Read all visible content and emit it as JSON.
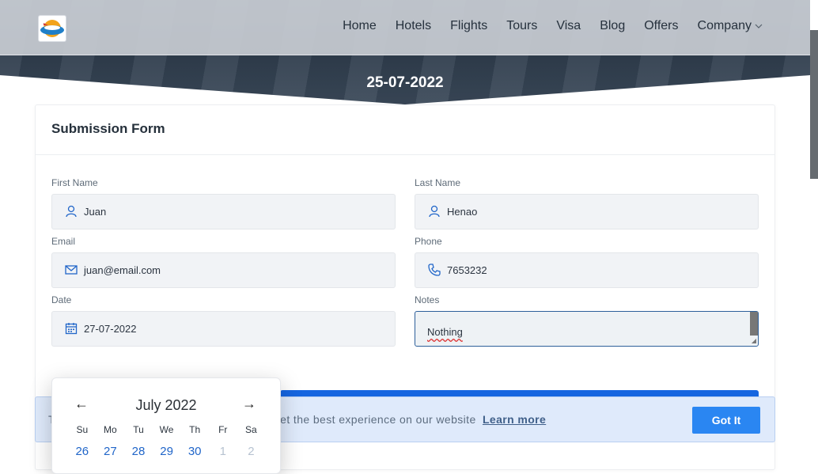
{
  "nav": {
    "logo": "logo-icon",
    "links": [
      "Home",
      "Hotels",
      "Flights",
      "Tours",
      "Visa",
      "Blog",
      "Offers",
      "Company"
    ]
  },
  "hero": {
    "date": "25-07-2022"
  },
  "form": {
    "title": "Submission Form",
    "first_name": {
      "label": "First Name",
      "value": "Juan"
    },
    "last_name": {
      "label": "Last Name",
      "value": "Henao"
    },
    "email": {
      "label": "Email",
      "value": "juan@email.com"
    },
    "phone": {
      "label": "Phone",
      "value": "7653232"
    },
    "date": {
      "label": "Date",
      "value": "27-07-2022"
    },
    "notes": {
      "label": "Notes",
      "value": "Nothing"
    }
  },
  "cookie": {
    "text_visible": "get the best experience on our website",
    "lead_char": "T",
    "link": "Learn more",
    "button": "Got It"
  },
  "datepicker": {
    "month": "July 2022",
    "prev": "←",
    "next": "→",
    "weekdays": [
      "Su",
      "Mo",
      "Tu",
      "We",
      "Th",
      "Fr",
      "Sa"
    ],
    "days": [
      "26",
      "27",
      "28",
      "29",
      "30",
      "1",
      "2"
    ]
  },
  "colors": {
    "accent": "#2a86f2",
    "primary": "#1565e0",
    "icon": "#2166c9"
  }
}
